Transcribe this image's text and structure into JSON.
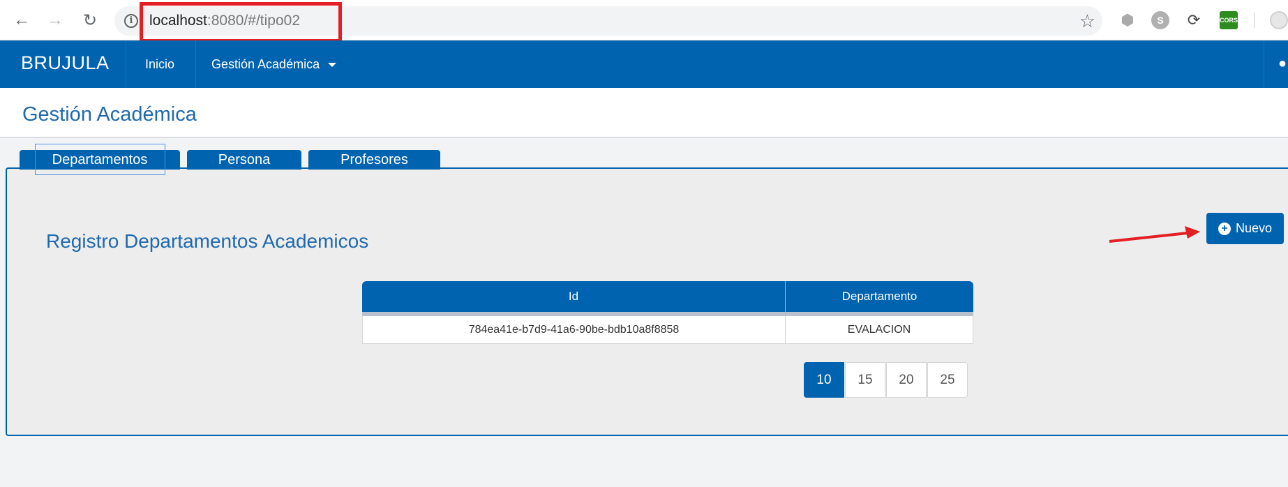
{
  "browser": {
    "url_host": "localhost",
    "url_path": ":8080/#/tipo02",
    "ext_cors": "CORS"
  },
  "app": {
    "brand": "BRUJULA",
    "nav": {
      "home": "Inicio",
      "academic": "Gestión Académica"
    }
  },
  "page": {
    "title": "Gestión Académica",
    "tabs": [
      "Departamentos",
      "Persona",
      "Profesores"
    ],
    "active_tab": "Departamentos"
  },
  "section": {
    "title": "Registro Departamentos Academicos",
    "new_button": "Nuevo"
  },
  "table": {
    "headers": [
      "Id",
      "Departamento"
    ],
    "rows": [
      [
        "784ea41e-b7d9-41a6-90be-bdb10a8f8858",
        "EVALACION"
      ]
    ]
  },
  "pagination": {
    "options": [
      "10",
      "15",
      "20",
      "25"
    ],
    "selected": "10"
  },
  "colors": {
    "primary": "#0063b0",
    "title": "#1f69ad",
    "highlight_box": "#e31e24",
    "annotation_arrow": "#e31e24"
  },
  "icons": {
    "back": "back-arrow-icon",
    "forward": "forward-arrow-icon",
    "reload": "reload-icon",
    "info": "info-icon",
    "bookmark": "star-icon",
    "new": "plus-circle-icon",
    "dropdown": "caret-down-icon",
    "user": "user-icon"
  }
}
